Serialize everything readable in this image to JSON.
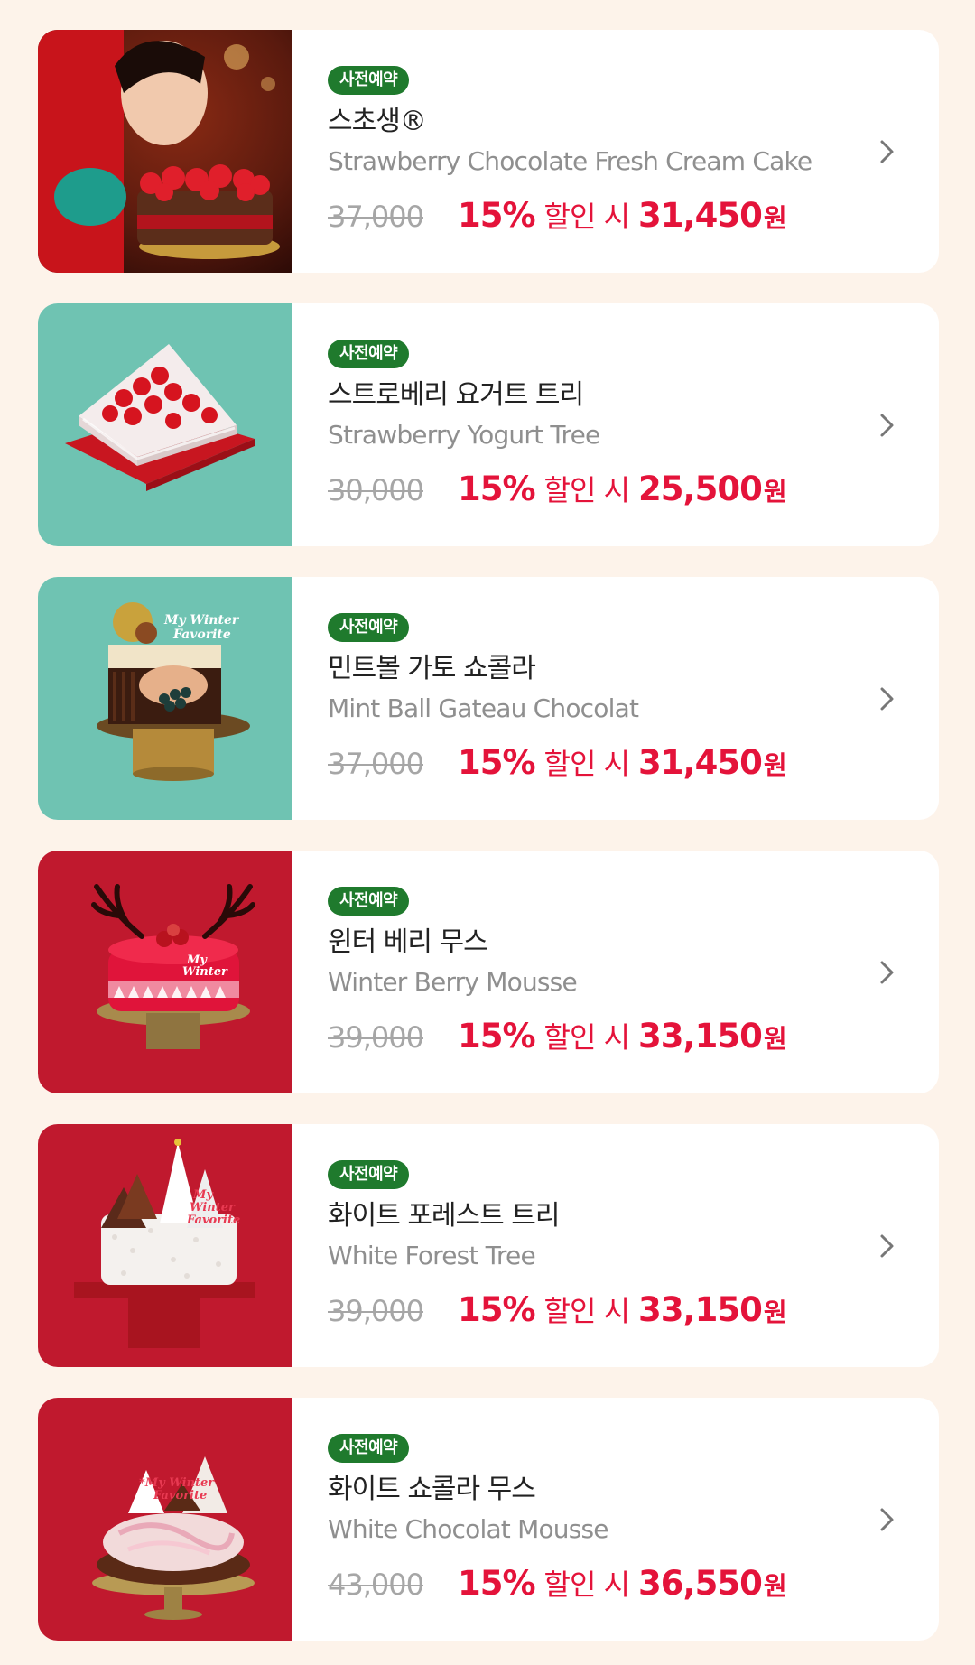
{
  "products": [
    {
      "badge": "사전예약",
      "name_ko": "스초생®",
      "name_en": "Strawberry Chocolate Fresh Cream Cake",
      "original_price": "37,000",
      "discount_percent": "15%",
      "discount_label": "할인 시",
      "sale_price": "31,450",
      "currency": "원",
      "thumb_bg": "#b8171f",
      "image_icon": "strawberry-chocolate-cake-image"
    },
    {
      "badge": "사전예약",
      "name_ko": "스트로베리 요거트 트리",
      "name_en": "Strawberry Yogurt Tree",
      "original_price": "30,000",
      "discount_percent": "15%",
      "discount_label": "할인 시",
      "sale_price": "25,500",
      "currency": "원",
      "thumb_bg": "#6fc3b2",
      "image_icon": "strawberry-yogurt-tree-image"
    },
    {
      "badge": "사전예약",
      "name_ko": "민트볼 가토 쇼콜라",
      "name_en": "Mint Ball Gateau Chocolat",
      "original_price": "37,000",
      "discount_percent": "15%",
      "discount_label": "할인 시",
      "sale_price": "31,450",
      "currency": "원",
      "thumb_bg": "#6fc3b2",
      "image_icon": "mint-ball-gateau-image"
    },
    {
      "badge": "사전예약",
      "name_ko": "윈터 베리 무스",
      "name_en": "Winter Berry Mousse",
      "original_price": "39,000",
      "discount_percent": "15%",
      "discount_label": "할인 시",
      "sale_price": "33,150",
      "currency": "원",
      "thumb_bg": "#c0192e",
      "image_icon": "winter-berry-mousse-image"
    },
    {
      "badge": "사전예약",
      "name_ko": "화이트 포레스트 트리",
      "name_en": "White Forest Tree",
      "original_price": "39,000",
      "discount_percent": "15%",
      "discount_label": "할인 시",
      "sale_price": "33,150",
      "currency": "원",
      "thumb_bg": "#c0192e",
      "image_icon": "white-forest-tree-image"
    },
    {
      "badge": "사전예약",
      "name_ko": "화이트 쇼콜라 무스",
      "name_en": "White Chocolat Mousse",
      "original_price": "43,000",
      "discount_percent": "15%",
      "discount_label": "할인 시",
      "sale_price": "36,550",
      "currency": "원",
      "thumb_bg": "#c0192e",
      "image_icon": "white-chocolat-mousse-image"
    }
  ],
  "colors": {
    "page_bg": "#fdf3ea",
    "badge_green": "#1f7a2d",
    "accent_red": "#e4133a",
    "strike_grey": "#a6a6a6",
    "english_grey": "#8f8f8f"
  }
}
